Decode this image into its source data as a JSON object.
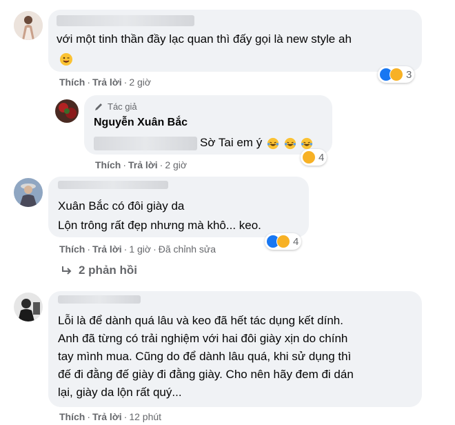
{
  "comments": [
    {
      "lines": [
        "với một tinh thần đầy lạc quan thì đấy gọi là new style ah"
      ],
      "like_label": "Thích",
      "reply_label": "Trả lời",
      "time": "2 giờ",
      "reaction_count": "3"
    },
    {
      "author_badge": "Tác giả",
      "author": "Nguyễn Xuân Bắc",
      "text": "Sờ Tai em ý",
      "like_label": "Thích",
      "reply_label": "Trả lời",
      "time": "2 giờ",
      "reaction_count": "4"
    },
    {
      "lines": [
        "Xuân Bắc có đôi giày da",
        "Lộn trông rất đẹp nhưng mà khô... keo."
      ],
      "like_label": "Thích",
      "reply_label": "Trả lời",
      "time": "1 giờ",
      "edited": "Đã chỉnh sửa",
      "reaction_count": "4",
      "replies_label": "2 phản hồi"
    },
    {
      "lines": [
        "Lỗi là để dành quá lâu và keo đã hết tác dụng kết dính.",
        "Anh đã từng có trải nghiệm với hai đôi giày xịn do chính",
        "tay mình mua. Cũng do để dành lâu quá, khi sử dụng thì",
        "đế đi đằng đế giày đi đằng giày. Cho nên hãy đem đi dán",
        "lại, giày da lộn rất quý..."
      ],
      "like_label": "Thích",
      "reply_label": "Trả lời",
      "time": "12 phút"
    }
  ],
  "separator": "·",
  "icons": {
    "reply_arrow": "reply-arrow-icon",
    "pencil": "pencil-icon",
    "like": "like-reaction-icon",
    "haha": "haha-reaction-icon"
  },
  "colors": {
    "bubble": "#f0f2f5",
    "meta": "#65676b",
    "like": "#1877f2",
    "haha": "#f7b125"
  }
}
